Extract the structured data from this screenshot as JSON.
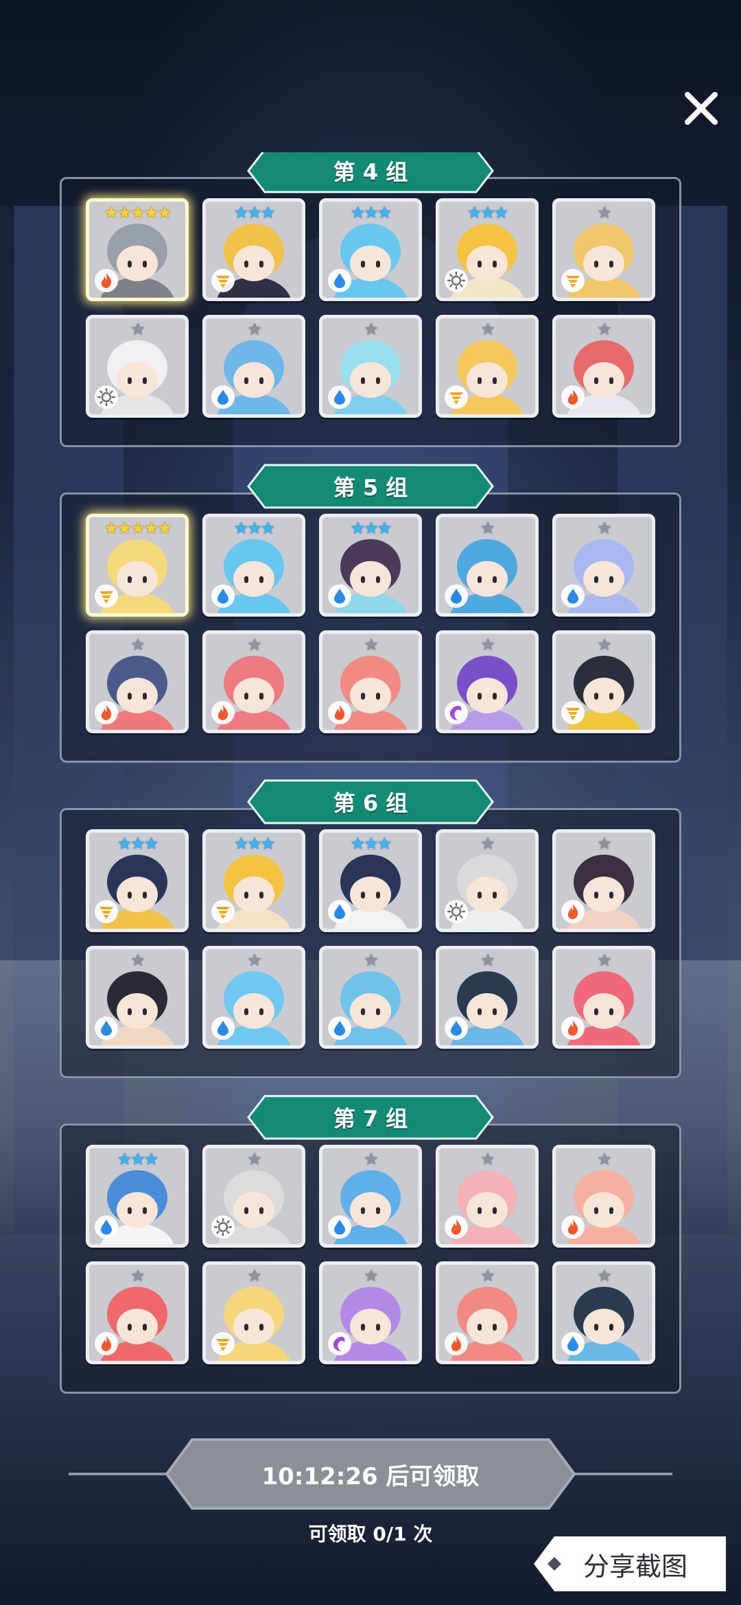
{
  "groups": [
    {
      "title": "第 4 组",
      "cards": [
        {
          "stars": 5,
          "tier": "gold",
          "element": "fire",
          "hue": "#7d8188",
          "hair": "#9aa0a8",
          "legend": true
        },
        {
          "stars": 3,
          "tier": "blue",
          "element": "thunder",
          "hue": "#2f2f45",
          "hair": "#f0c24a"
        },
        {
          "stars": 3,
          "tier": "blue",
          "element": "water",
          "hue": "#68c7ee",
          "hair": "#68c7ee"
        },
        {
          "stars": 3,
          "tier": "blue",
          "element": "light",
          "hue": "#f3e6c6",
          "hair": "#f5c342"
        },
        {
          "stars": 1,
          "tier": "gray",
          "element": "thunder",
          "hue": "#f2c66a",
          "hair": "#f2c66a"
        },
        {
          "stars": 1,
          "tier": "gray",
          "element": "light",
          "hue": "#e6e6e6",
          "hair": "#f0f0f0"
        },
        {
          "stars": 1,
          "tier": "gray",
          "element": "water",
          "hue": "#6db8e8",
          "hair": "#6db8e8"
        },
        {
          "stars": 1,
          "tier": "gray",
          "element": "water",
          "hue": "#7fd0ee",
          "hair": "#9adfee"
        },
        {
          "stars": 1,
          "tier": "gray",
          "element": "thunder",
          "hue": "#f3c85c",
          "hair": "#f3c85c"
        },
        {
          "stars": 1,
          "tier": "gray",
          "element": "fire",
          "hue": "#e8e8f0",
          "hair": "#e66a6a"
        }
      ]
    },
    {
      "title": "第 5 组",
      "cards": [
        {
          "stars": 5,
          "tier": "gold",
          "element": "thunder",
          "hue": "#f5d97a",
          "hair": "#f5d97a",
          "legend": true
        },
        {
          "stars": 3,
          "tier": "blue",
          "element": "water",
          "hue": "#68c7ee",
          "hair": "#68c7ee"
        },
        {
          "stars": 3,
          "tier": "blue",
          "element": "water",
          "hue": "#8fd8ea",
          "hair": "#4a3b5c"
        },
        {
          "stars": 1,
          "tier": "gray",
          "element": "water",
          "hue": "#4fa8e0",
          "hair": "#4fa8e0"
        },
        {
          "stars": 1,
          "tier": "gray",
          "element": "water",
          "hue": "#aab8f0",
          "hair": "#aab8f0"
        },
        {
          "stars": 1,
          "tier": "gray",
          "element": "fire",
          "hue": "#f07878",
          "hair": "#4a5a8a"
        },
        {
          "stars": 1,
          "tier": "gray",
          "element": "fire",
          "hue": "#ee7a82",
          "hair": "#ee7a82"
        },
        {
          "stars": 1,
          "tier": "gray",
          "element": "fire",
          "hue": "#f08a82",
          "hair": "#f08a82"
        },
        {
          "stars": 1,
          "tier": "gray",
          "element": "dark",
          "hue": "#b59ae8",
          "hair": "#7a4fc8"
        },
        {
          "stars": 1,
          "tier": "gray",
          "element": "thunder",
          "hue": "#f0c83e",
          "hair": "#2a2f3a"
        }
      ]
    },
    {
      "title": "第 6 组",
      "cards": [
        {
          "stars": 3,
          "tier": "blue",
          "element": "thunder",
          "hue": "#f0c24a",
          "hair": "#2a3558"
        },
        {
          "stars": 3,
          "tier": "blue",
          "element": "thunder",
          "hue": "#f5e2c2",
          "hair": "#f5c342"
        },
        {
          "stars": 3,
          "tier": "blue",
          "element": "water",
          "hue": "#f2f2f2",
          "hair": "#2a3558"
        },
        {
          "stars": 1,
          "tier": "gray",
          "element": "light",
          "hue": "#eeeeee",
          "hair": "#dadada"
        },
        {
          "stars": 1,
          "tier": "gray",
          "element": "fire",
          "hue": "#f2d2c2",
          "hair": "#3a3040"
        },
        {
          "stars": 1,
          "tier": "gray",
          "element": "water",
          "hue": "#f2d8c2",
          "hair": "#2a2a35"
        },
        {
          "stars": 1,
          "tier": "gray",
          "element": "water",
          "hue": "#6ec8f0",
          "hair": "#6ec8f0"
        },
        {
          "stars": 1,
          "tier": "gray",
          "element": "water",
          "hue": "#70c2ea",
          "hair": "#70c2ea"
        },
        {
          "stars": 1,
          "tier": "gray",
          "element": "water",
          "hue": "#6ab8e6",
          "hair": "#2a3a50"
        },
        {
          "stars": 1,
          "tier": "gray",
          "element": "fire",
          "hue": "#ee6a78",
          "hair": "#ee6a78"
        }
      ]
    },
    {
      "title": "第 7 组",
      "cards": [
        {
          "stars": 3,
          "tier": "blue",
          "element": "water",
          "hue": "#f5f5f5",
          "hair": "#4a8ed8"
        },
        {
          "stars": 1,
          "tier": "gray",
          "element": "light",
          "hue": "#dcdcdc",
          "hair": "#dcdcdc"
        },
        {
          "stars": 1,
          "tier": "gray",
          "element": "water",
          "hue": "#5fb0e8",
          "hair": "#5fb0e8"
        },
        {
          "stars": 1,
          "tier": "gray",
          "element": "fire",
          "hue": "#f2b2b8",
          "hair": "#f2b2b8"
        },
        {
          "stars": 1,
          "tier": "gray",
          "element": "fire",
          "hue": "#f5b0a0",
          "hair": "#f5b0a0"
        },
        {
          "stars": 1,
          "tier": "gray",
          "element": "fire",
          "hue": "#ee6a6a",
          "hair": "#ee6a6a"
        },
        {
          "stars": 1,
          "tier": "gray",
          "element": "thunder",
          "hue": "#f6d67a",
          "hair": "#f6d67a"
        },
        {
          "stars": 1,
          "tier": "gray",
          "element": "dark",
          "hue": "#b488e6",
          "hair": "#b488e6"
        },
        {
          "stars": 1,
          "tier": "gray",
          "element": "fire",
          "hue": "#f08a82",
          "hair": "#f08a82"
        },
        {
          "stars": 1,
          "tier": "gray",
          "element": "water",
          "hue": "#6ab8e6",
          "hair": "#2a3a50"
        }
      ]
    }
  ],
  "claim_button": {
    "label": "10:12:26 后可领取"
  },
  "claim_count": "可领取 0/1 次",
  "share_button": {
    "label": "分享截图"
  },
  "colors": {
    "banner_teal": "#128a74",
    "banner_border": "#e7fbf4",
    "button_gray": "#8b8f98",
    "element_fire": "#f05a2a",
    "element_water": "#2a8ae6",
    "element_thunder": "#f0a81e",
    "element_light": "#707070",
    "element_dark": "#a048e0"
  }
}
